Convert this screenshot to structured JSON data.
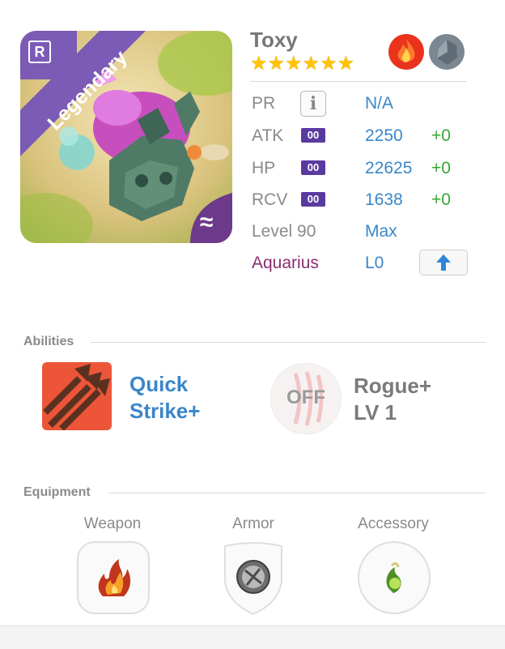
{
  "unit": {
    "name": "Toxy",
    "stars": "★★★★★★",
    "rarity": "Legendary",
    "corner_icon": "R",
    "element_icons": [
      "fire-icon",
      "stone-icon"
    ]
  },
  "stats": {
    "pr": {
      "label": "PR",
      "value": "N/A"
    },
    "atk": {
      "label": "ATK",
      "badge": "00",
      "value": "2250",
      "bonus": "+0"
    },
    "hp": {
      "label": "HP",
      "badge": "00",
      "value": "22625",
      "bonus": "+0"
    },
    "rcv": {
      "label": "RCV",
      "badge": "00",
      "value": "1638",
      "bonus": "+0"
    },
    "level": {
      "label": "Level 90",
      "value": "Max"
    },
    "zodiac": {
      "label": "Aquarius",
      "value": "L0"
    }
  },
  "abilities": {
    "title": "Abilities",
    "primary": {
      "line1": "Quick",
      "line2": "Strike+"
    },
    "secondary": {
      "status": "OFF",
      "line1": "Rogue+",
      "line2": "LV 1"
    }
  },
  "equipment": {
    "title": "Equipment",
    "slots": [
      {
        "label": "Weapon",
        "icon": "flame-weapon-icon"
      },
      {
        "label": "Armor",
        "icon": "gray-orb-armor-icon"
      },
      {
        "label": "Accessory",
        "icon": "green-gem-accessory-icon"
      }
    ]
  },
  "colors": {
    "blue": "#3a86c8",
    "green": "#35a835",
    "purple": "#8a2f72",
    "badge": "#5b3aa0",
    "star": "#ffc400"
  }
}
